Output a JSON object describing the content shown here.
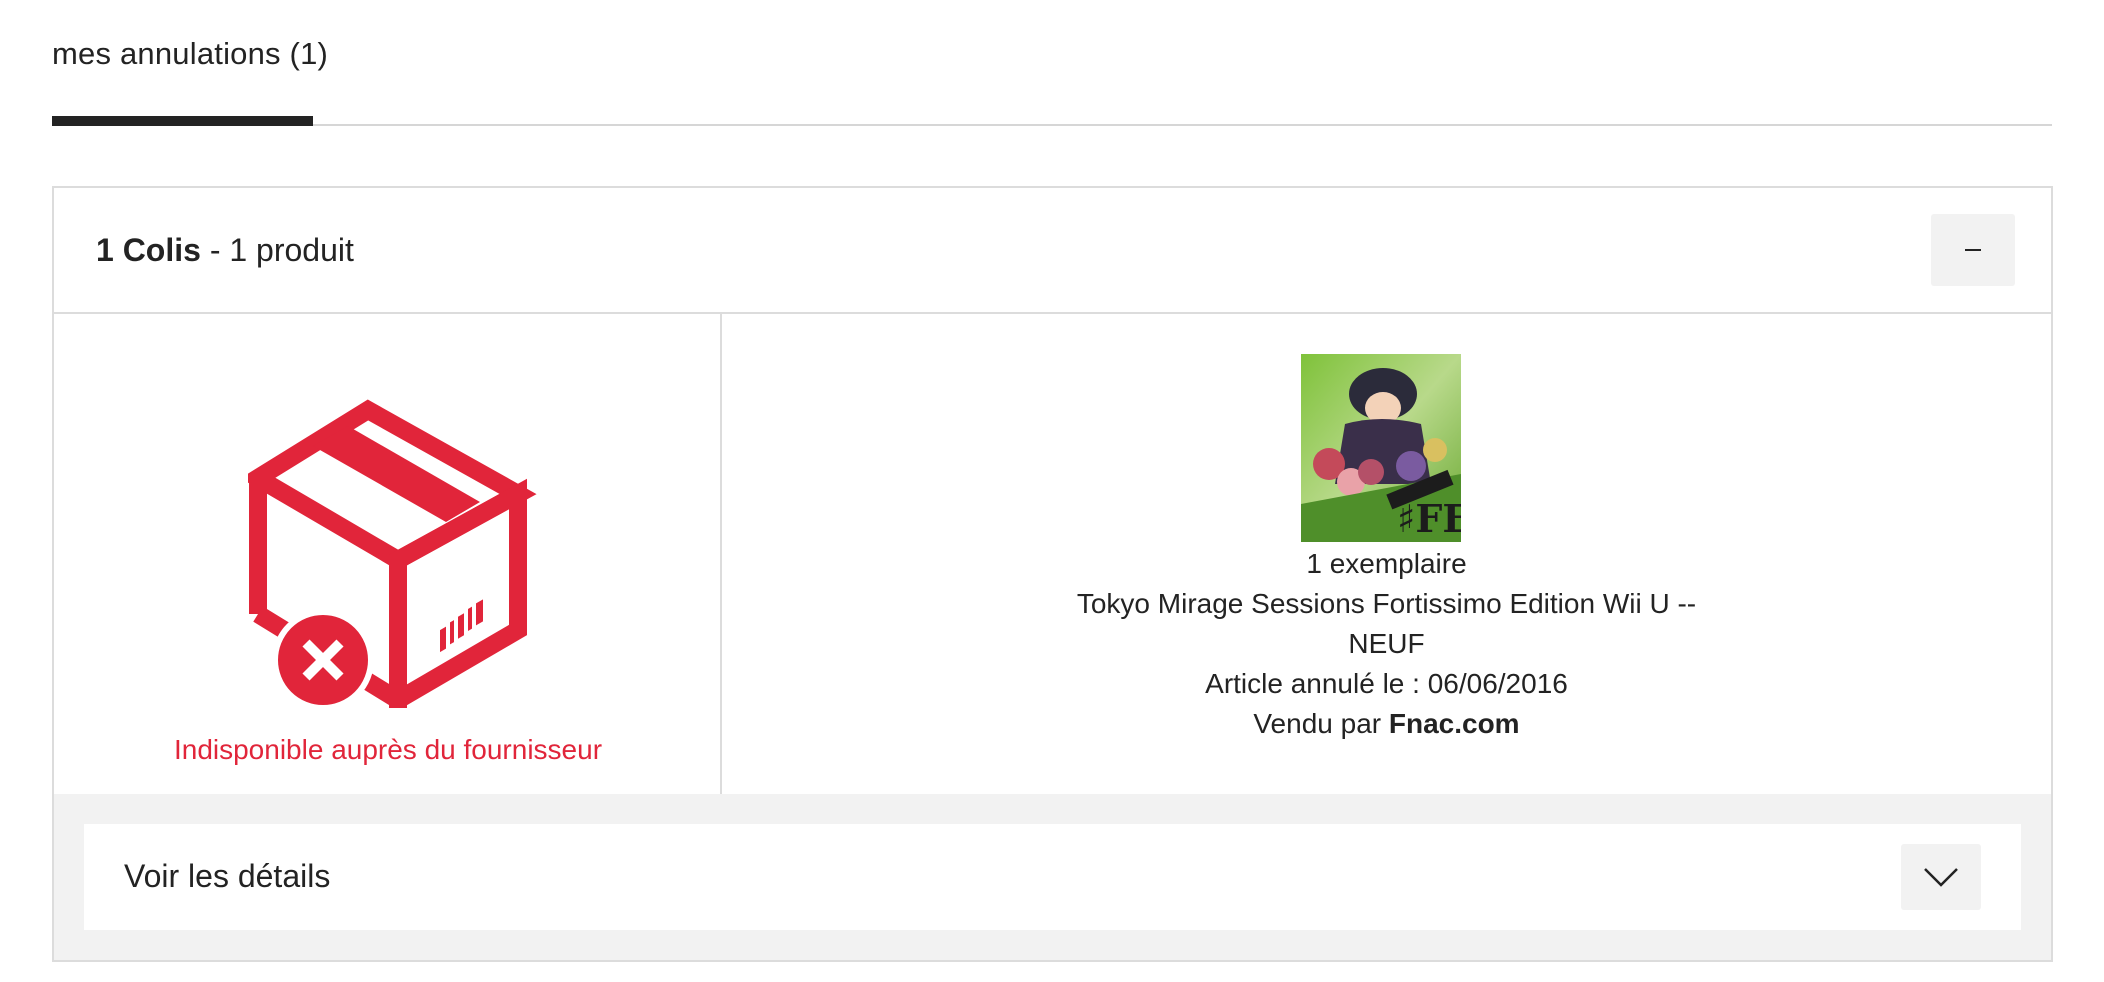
{
  "tabs": [
    {
      "label": "mes annulations (1)",
      "active": true
    }
  ],
  "package": {
    "count_label": "1 Colis",
    "separator": " - ",
    "products_label": "1 produit",
    "collapse_symbol": "–",
    "status": {
      "icon": "package-cancelled-icon",
      "text": "Indisponible auprès du fournisseur",
      "color": "#e1253a"
    },
    "product": {
      "image": "product-cover-image",
      "quantity": "1 exemplaire",
      "name": "Tokyo Mirage Sessions Fortissimo Edition Wii U -- NEUF",
      "cancel_text": "Article annulé le : 06/06/2016",
      "sold_by_prefix": "Vendu par ",
      "seller": "Fnac.com"
    },
    "details": {
      "label": "Voir les détails",
      "icon": "chevron-down-icon"
    }
  },
  "colors": {
    "accent_red": "#e1253a",
    "text": "#232323",
    "border": "#dcdcdc",
    "button_bg": "#f2f2f2"
  }
}
